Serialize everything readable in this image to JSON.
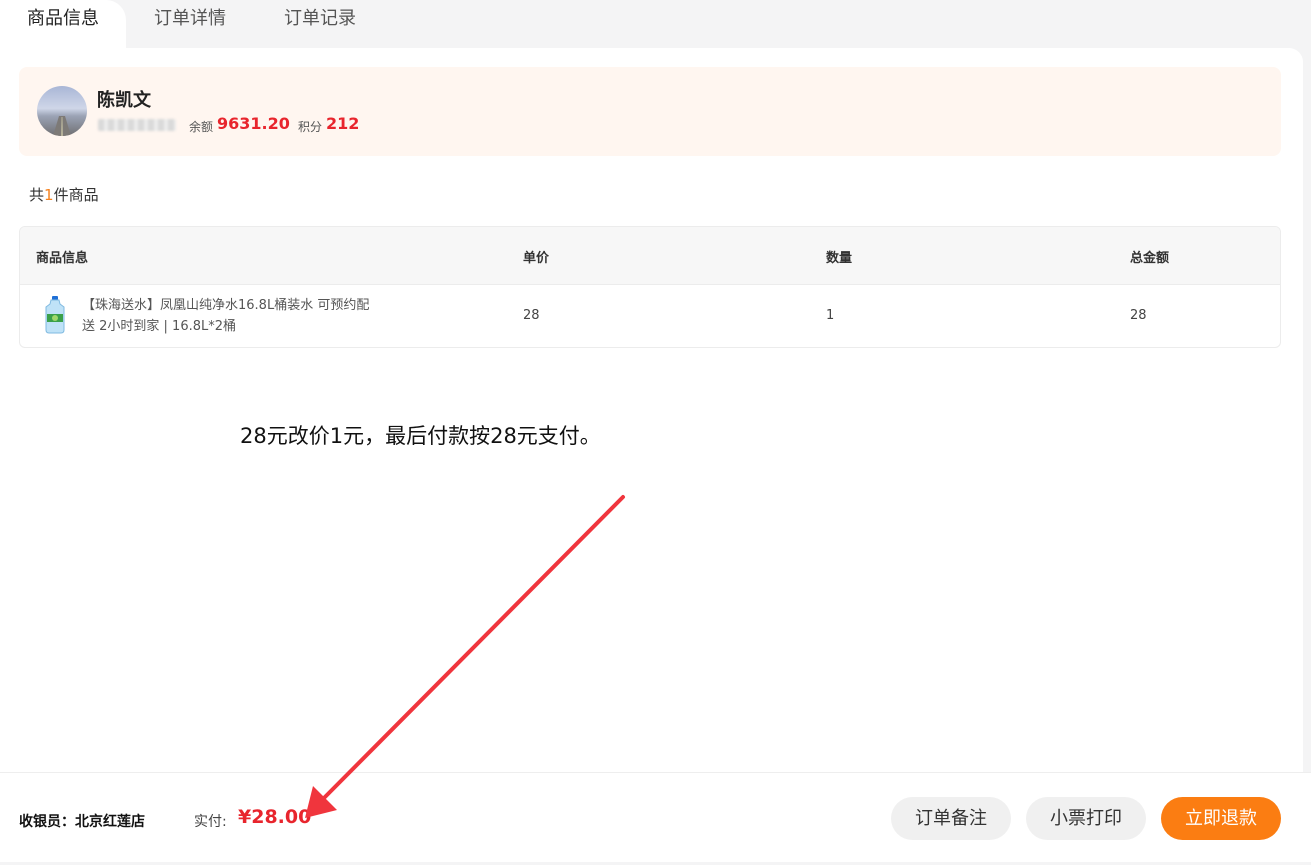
{
  "tabs": [
    {
      "label": "商品信息",
      "active": true
    },
    {
      "label": "订单详情",
      "active": false
    },
    {
      "label": "订单记录",
      "active": false
    }
  ],
  "member": {
    "name": "陈凯文",
    "balance_label": "余额",
    "balance_value": "9631.20",
    "points_label": "积分",
    "points_value": "212"
  },
  "summary": {
    "prefix": "共",
    "count": "1",
    "suffix": "件商品"
  },
  "table": {
    "headers": [
      "商品信息",
      "单价",
      "数量",
      "总金额"
    ],
    "rows": [
      {
        "name": "【珠海送水】凤凰山纯净水16.8L桶装水 可预约配送 2小时到家 | 16.8L*2桶",
        "unit_price": "28",
        "quantity": "1",
        "total": "28"
      }
    ]
  },
  "annotation": "28元改价1元，最后付款按28元支付。",
  "footer": {
    "cashier_label": "收银员：北京红莲店",
    "paid_label": "实付:",
    "paid_value": "¥28.00",
    "buttons": {
      "remark": "订单备注",
      "print": "小票打印",
      "refund": "立即退款"
    }
  },
  "colors": {
    "accent_red": "#e8252d",
    "accent_orange": "#fb7d12",
    "member_bg": "#fff6f0",
    "annotation_arrow": "#f0353d"
  },
  "icons": {
    "product_image": "water-bottle-icon",
    "avatar": "user-avatar",
    "annotation_arrow": "red-arrow"
  }
}
